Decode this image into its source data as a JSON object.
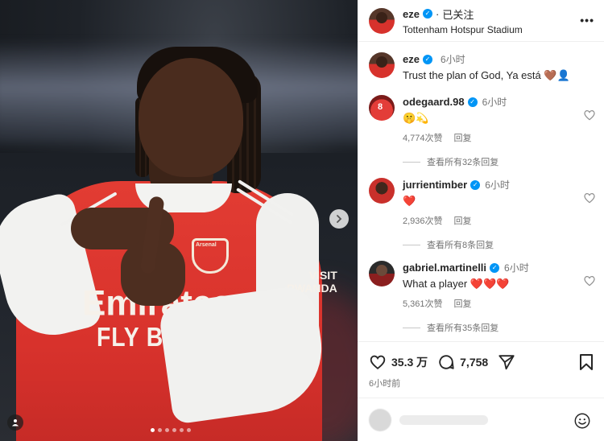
{
  "post": {
    "author": "eze",
    "follow_label": "已关注",
    "separator": "·",
    "location": "Tottenham Hotspur Stadium",
    "more_label": "•••"
  },
  "photo": {
    "sponsor_line1": "Emirates",
    "sponsor_line2": "FLY BETTER",
    "crest_text": "Arsenal",
    "sleeve_text": "VISIT\nRWANDA",
    "slides_total": 6,
    "slide_active": 1
  },
  "caption": {
    "author": "eze",
    "time": "6小时",
    "text": "Trust the plan of God, Ya está",
    "emojis": "🤎👤"
  },
  "comments": [
    {
      "user": "odegaard.98",
      "time": "6小时",
      "text": "🤫💫",
      "likes": "4,774次赞",
      "reply": "回复",
      "view_replies": "查看所有32条回复"
    },
    {
      "user": "jurrientimber",
      "time": "6小时",
      "text": "❤️",
      "likes": "2,936次赞",
      "reply": "回复",
      "view_replies": "查看所有8条回复"
    },
    {
      "user": "gabriel.martinelli",
      "time": "6小时",
      "text": "What a player ❤️❤️❤️",
      "likes": "5,361次赞",
      "reply": "回复",
      "view_replies": "查看所有35条回复"
    }
  ],
  "actions": {
    "like_count": "35.3 万",
    "comment_count": "7,758",
    "posted_ago": "6小时前"
  },
  "icons": {
    "verified": "verified-badge-icon",
    "like": "heart-icon",
    "comment": "comment-bubble-icon",
    "share": "paper-plane-icon",
    "save": "bookmark-icon",
    "emoji": "smiley-icon",
    "next": "chevron-right-icon",
    "tag": "user-tag-icon"
  },
  "colors": {
    "verified_blue": "#0095f6",
    "text_primary": "#262626",
    "text_secondary": "#737373",
    "divider": "#efefef"
  }
}
